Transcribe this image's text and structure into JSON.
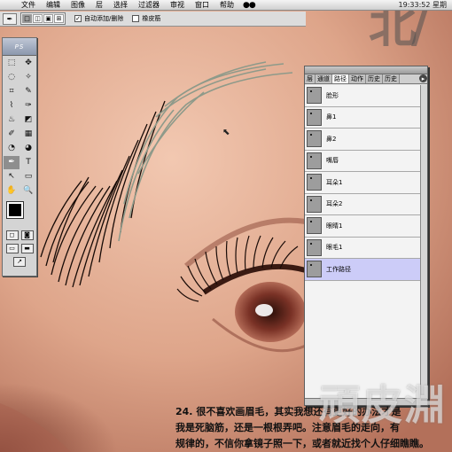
{
  "menubar": {
    "apple_symbol": "",
    "items": [
      "文件",
      "编辑",
      "图像",
      "层",
      "选择",
      "过滤器",
      "审视",
      "窗口",
      "帮助"
    ],
    "clock": "19:33:52 星期"
  },
  "optionsbar": {
    "tool_glyph": "✒",
    "auto_add_delete_label": "自动添加/删除",
    "auto_add_delete_checked": true,
    "rubber_band_label": "橡皮筋",
    "rubber_band_checked": false
  },
  "toolbox": {
    "tools": [
      "⬚",
      "✥",
      "◌",
      "✧",
      "⌗",
      "✎",
      "⌇",
      "✑",
      "♨",
      "◩",
      "✐",
      "▦",
      "◔",
      "◕",
      "✒",
      "T",
      "↖",
      "▭",
      "✋",
      "🔍"
    ]
  },
  "panel": {
    "tabs": [
      "层",
      "通道",
      "路径",
      "动作",
      "历史",
      "历史"
    ],
    "active_tab_index": 2,
    "paths": [
      {
        "label": "脸形"
      },
      {
        "label": "鼻1"
      },
      {
        "label": "鼻2"
      },
      {
        "label": "嘴唇"
      },
      {
        "label": "耳朵1"
      },
      {
        "label": "耳朵2"
      },
      {
        "label": "眼睛1"
      },
      {
        "label": "眼毛1"
      },
      {
        "label": "工作路径"
      }
    ],
    "selected_path_index": 8
  },
  "caption": {
    "line1": "24. 很不喜欢画眉毛，其实我想还有更好的办法才是",
    "line2": "我是死脑筋，还是一根根弄吧。注意眉毛的走向，有",
    "line3": "规律的，不信你拿镜子照一下，或者就近找个人仔细瞧瞧。"
  },
  "watermarks": {
    "top": "北/",
    "bottom": "頑皮淵"
  },
  "colors": {
    "skin": "#d9a78d",
    "selected_row": "#ccccf8",
    "foreground": "#000000",
    "background": "#000000"
  }
}
